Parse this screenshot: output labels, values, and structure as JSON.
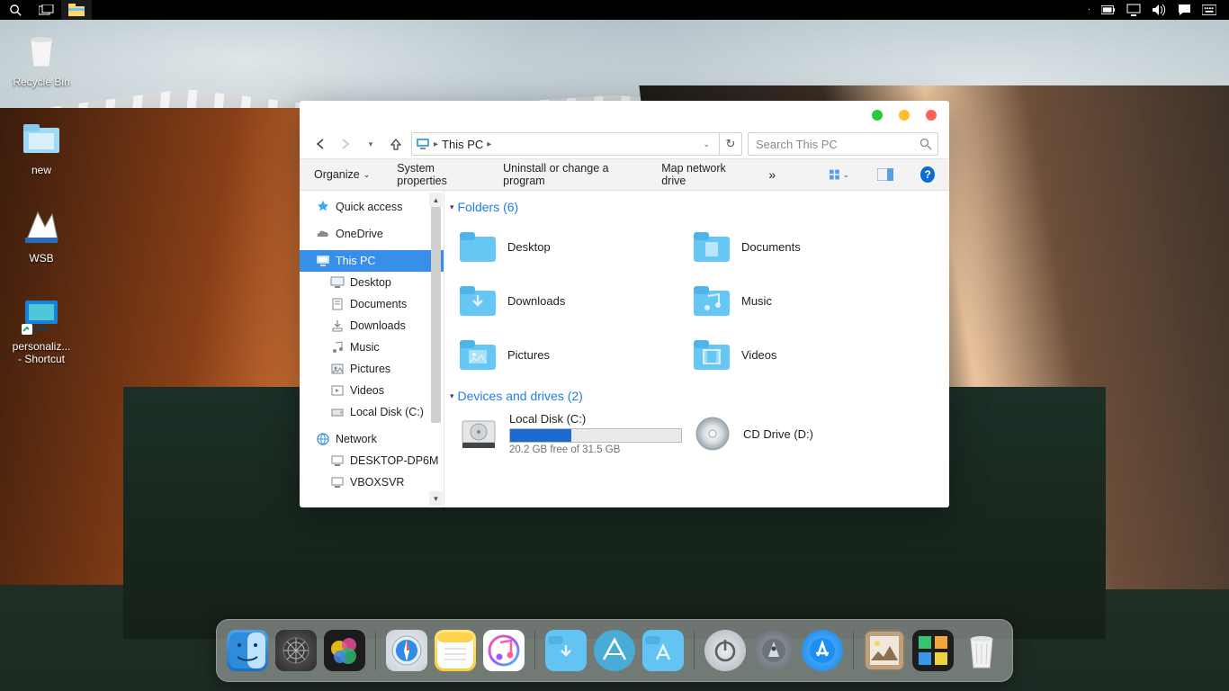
{
  "desktop_icons": [
    {
      "label": "Recycle Bin",
      "key": "recycle-bin"
    },
    {
      "label": "new",
      "key": "new-folder"
    },
    {
      "label": "WSB",
      "key": "wsb"
    },
    {
      "label": "personaliz...\n- Shortcut",
      "key": "personalization-shortcut"
    }
  ],
  "window": {
    "breadcrumb": "This PC",
    "search_placeholder": "Search This PC",
    "toolbar": {
      "organize": "Organize",
      "sys": "System properties",
      "uninstall": "Uninstall or change a program",
      "map": "Map network drive"
    },
    "tree": {
      "quick": "Quick access",
      "onedrive": "OneDrive",
      "thispc": "This PC",
      "desktop": "Desktop",
      "documents": "Documents",
      "downloads": "Downloads",
      "music": "Music",
      "pictures": "Pictures",
      "videos": "Videos",
      "localdisk": "Local Disk (C:)",
      "network": "Network",
      "host1": "DESKTOP-DP6M",
      "host2": "VBOXSVR"
    },
    "folders_header": "Folders (6)",
    "folders": [
      {
        "label": "Desktop"
      },
      {
        "label": "Documents"
      },
      {
        "label": "Downloads"
      },
      {
        "label": "Music"
      },
      {
        "label": "Pictures"
      },
      {
        "label": "Videos"
      }
    ],
    "drives_header": "Devices and drives (2)",
    "drive_c": {
      "label": "Local Disk (C:)",
      "free": "20.2 GB free of 31.5 GB"
    },
    "drive_d": {
      "label": "CD Drive (D:)"
    }
  }
}
